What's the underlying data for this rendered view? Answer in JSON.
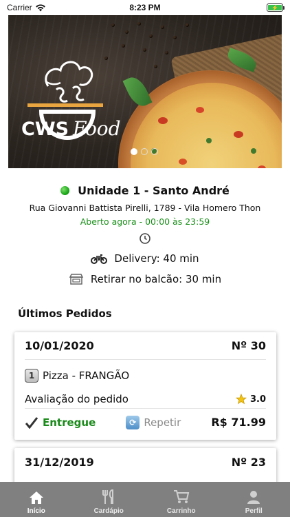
{
  "status_bar": {
    "carrier": "Carrier",
    "time": "8:23 PM"
  },
  "banner": {
    "brand_main": "CWS",
    "brand_italic": "Food",
    "carousel_pages": 3,
    "carousel_active": 1
  },
  "store": {
    "name": "Unidade 1 - Santo André",
    "address": "Rua Giovanni Battista Pirelli, 1789 - Vila Homero Thon",
    "hours": "Aberto agora - 00:00 às 23:59",
    "delivery": "Delivery: 40 min",
    "pickup": "Retirar no balcão: 30 min",
    "status_color": "#14a314"
  },
  "orders_section": {
    "title": "Últimos Pedidos",
    "orders": [
      {
        "date": "10/01/2020",
        "number": "Nº 30",
        "item_qty": "1",
        "item_name": "Pizza - FRANGÃO",
        "rating_label": "Avaliação do pedido",
        "rating_value": "3.0",
        "status": "Entregue",
        "repeat_label": "Repetir",
        "price": "R$ 71.99"
      },
      {
        "date": "31/12/2019",
        "number": "Nº 23"
      }
    ]
  },
  "tabbar": {
    "tabs": [
      {
        "label": "Início",
        "icon": "home-icon",
        "active": true
      },
      {
        "label": "Cardápio",
        "icon": "cutlery-icon",
        "active": false
      },
      {
        "label": "Carrinho",
        "icon": "cart-icon",
        "active": false
      },
      {
        "label": "Perfil",
        "icon": "user-icon",
        "active": false
      }
    ]
  }
}
